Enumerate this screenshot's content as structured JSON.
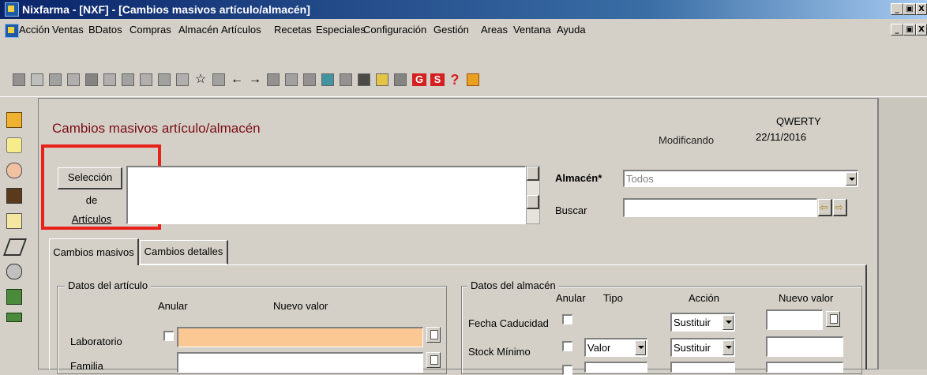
{
  "window": {
    "title": "Nixfarma - [NXF] - [Cambios masivos artículo/almacén]",
    "min_glyph": "_",
    "restore_glyph": "▣",
    "close_glyph": "X"
  },
  "menu": {
    "items": [
      "Acción",
      "Ventas",
      "BDatos",
      "Compras",
      "Almacén",
      "Artículos",
      "Recetas",
      "Especiales",
      "Configuración",
      "Gestión",
      "Areas",
      "Ventana",
      "Ayuda"
    ]
  },
  "toolbar": {
    "icons": [
      "ficha-icon",
      "list-icon",
      "edit-icon",
      "disk-icon",
      "print-icon",
      "pencil-icon",
      "grid-icon",
      "doc-icon",
      "table-icon",
      "doc2-icon",
      "star-icon",
      "export-icon",
      "arrow-left-icon",
      "arrow-right-icon",
      "import-icon",
      "printer-icon",
      "search-icon",
      "tools-icon",
      "home-icon",
      "stop-icon",
      "monitor-icon",
      "cart-icon",
      "g-icon",
      "s-icon",
      "help-icon",
      "exit-icon"
    ],
    "g_label": "G",
    "s_label": "S",
    "help_label": "?",
    "colors": {
      "g": "#d42020",
      "s": "#d42020",
      "help": "#d42020"
    }
  },
  "form": {
    "title": "Cambios masivos artículo/almacén",
    "status": "Modificando",
    "user": "QWERTY",
    "date": "22/11/2016",
    "seleccion_button": "Selección de Artículos",
    "almacen_label": "Almacén*",
    "almacen_value": "Todos",
    "buscar_label": "Buscar",
    "tabs": [
      "Cambios masivos",
      "Cambios detalles"
    ],
    "articulo_group": {
      "title": "Datos del artículo",
      "anular_header": "Anular",
      "nuevo_valor_header": "Nuevo valor",
      "rows": [
        {
          "label": "Laboratorio",
          "value": ""
        },
        {
          "label": "Familia",
          "value": ""
        }
      ]
    },
    "almacen_group": {
      "title": "Datos del almacén",
      "anular_header": "Anular",
      "tipo_header": "Tipo",
      "accion_header": "Acción",
      "nuevo_valor_header": "Nuevo valor",
      "rows": [
        {
          "label": "Fecha Caducidad",
          "tipo": "",
          "accion": "Sustituir",
          "value": ""
        },
        {
          "label": "Stock Mínimo",
          "tipo": "Valor",
          "accion": "Sustituir",
          "value": ""
        }
      ]
    }
  },
  "highlight_color": "#e8211b",
  "laboratorio_field_color": "#fbc894"
}
